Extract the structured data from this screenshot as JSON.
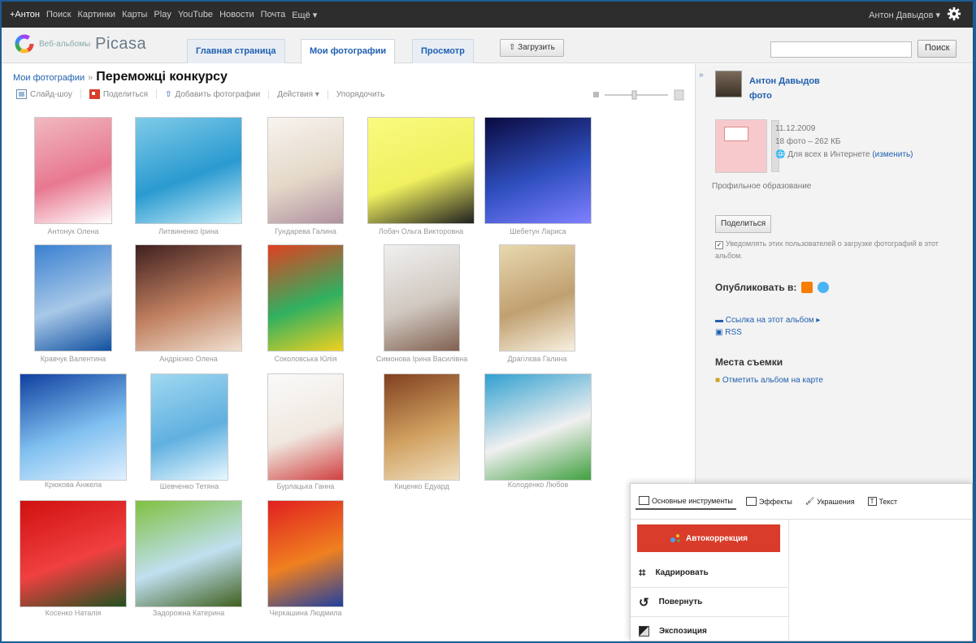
{
  "gbar": {
    "links": [
      "+Антон",
      "Поиск",
      "Картинки",
      "Карты",
      "Play",
      "YouTube",
      "Новости",
      "Почта",
      "Ещё ▾"
    ],
    "user": "Антон Давыдов ▾",
    "gear_icon": "gear-icon"
  },
  "header": {
    "logo_sub": "Веб-альбомы",
    "logo_name": "Picasa",
    "tabs": [
      "Главная страница",
      "Мои фотографии",
      "Просмотр"
    ],
    "active_tab": "Мои фотографии",
    "upload_label": "Загрузить",
    "search_placeholder": "",
    "search_button": "Поиск"
  },
  "crumb": {
    "parent": "Мои фотографии",
    "title": "Переможці конкурсу"
  },
  "toolbar": {
    "slideshow": "Слайд-шоу",
    "share": "Поделиться",
    "add_photos": "Добавить фотографии",
    "actions": "Действия ▾",
    "sort": "Упорядочить"
  },
  "photos": [
    {
      "caption": "Антонук Олена",
      "colors": [
        "#f0b8c0",
        "#e87890",
        "#ffffff"
      ]
    },
    {
      "caption": "Литвиненко Ірина",
      "colors": [
        "#7fcbe8",
        "#2a9ad0",
        "#c8ecf8"
      ]
    },
    {
      "caption": "Гундарева Галина",
      "colors": [
        "#f8f4f0",
        "#e4d8c8",
        "#b090a0"
      ]
    },
    {
      "caption": "Лобач Ольга Викторовна",
      "colors": [
        "#fafa80",
        "#f0f060",
        "#202020"
      ]
    },
    {
      "caption": "Шебетун Лариса",
      "colors": [
        "#0a0a40",
        "#3050c0",
        "#8080ff"
      ]
    },
    {
      "caption": "Кравчук Валентина",
      "colors": [
        "#3a80d0",
        "#a8c8e8",
        "#1050a0"
      ]
    },
    {
      "caption": "Андрієнко Олена",
      "colors": [
        "#402020",
        "#c08060",
        "#f0e0d0"
      ]
    },
    {
      "caption": "Соколовська Юлія",
      "colors": [
        "#e04020",
        "#30b060",
        "#f0d020"
      ]
    },
    {
      "caption": "Симонова Ірина Василівна",
      "colors": [
        "#f0f0f0",
        "#d0c8c0",
        "#806050"
      ]
    },
    {
      "caption": "Драгілєва Галина",
      "colors": [
        "#e8d8b0",
        "#c0a070",
        "#f8f0e0"
      ]
    },
    {
      "caption": "Крюкова Анжела",
      "colors": [
        "#1040a0",
        "#80c0f0",
        "#e0f0ff"
      ]
    },
    {
      "caption": "Шевченко Тетяна",
      "colors": [
        "#a0d8f0",
        "#60b0e0",
        "#e8f8ff"
      ]
    },
    {
      "caption": "Бурлацька Ганна",
      "colors": [
        "#fafafa",
        "#f0e8e0",
        "#d04040"
      ]
    },
    {
      "caption": "Киценко Едуард",
      "colors": [
        "#804020",
        "#d0a060",
        "#f0e0c0"
      ]
    },
    {
      "caption": "Колоденко Любов",
      "colors": [
        "#30a0d0",
        "#f0f0f0",
        "#40a040"
      ]
    },
    {
      "caption": "Косенко Наталія",
      "colors": [
        "#d01010",
        "#f04040",
        "#205020"
      ]
    },
    {
      "caption": "Задорожна Катерина",
      "colors": [
        "#80c040",
        "#c0e0f0",
        "#406020"
      ]
    },
    {
      "caption": "Черкашина Людмила",
      "colors": [
        "#e02020",
        "#f08020",
        "#2040a0"
      ]
    }
  ],
  "sidebar": {
    "collapse": "»",
    "owner_name": "Антон Давыдов",
    "owner_sub": "фото",
    "album_date": "11.12.2009",
    "album_stats": "18 фото – 262 КБ",
    "album_access": "Для всех в Интернете",
    "album_change": "(изменить)",
    "album_desc": "Профильное образование",
    "share_button": "Поделиться",
    "notify_text": "Уведомлять этих пользователей о загрузке фотографий в этот альбом.",
    "publish_label": "Опубликовать в:",
    "album_link": "Ссылка на этот альбом ▸",
    "rss": "RSS",
    "places_heading": "Места съемки",
    "places_link": "Отметить альбом на карте"
  },
  "editor": {
    "tabs": [
      "Основные инструменты",
      "Эффекты",
      "Украшения",
      "Текст"
    ],
    "autofix": "Автокоррекция",
    "tools": [
      "Кадрировать",
      "Повернуть",
      "Экспозиция"
    ]
  }
}
